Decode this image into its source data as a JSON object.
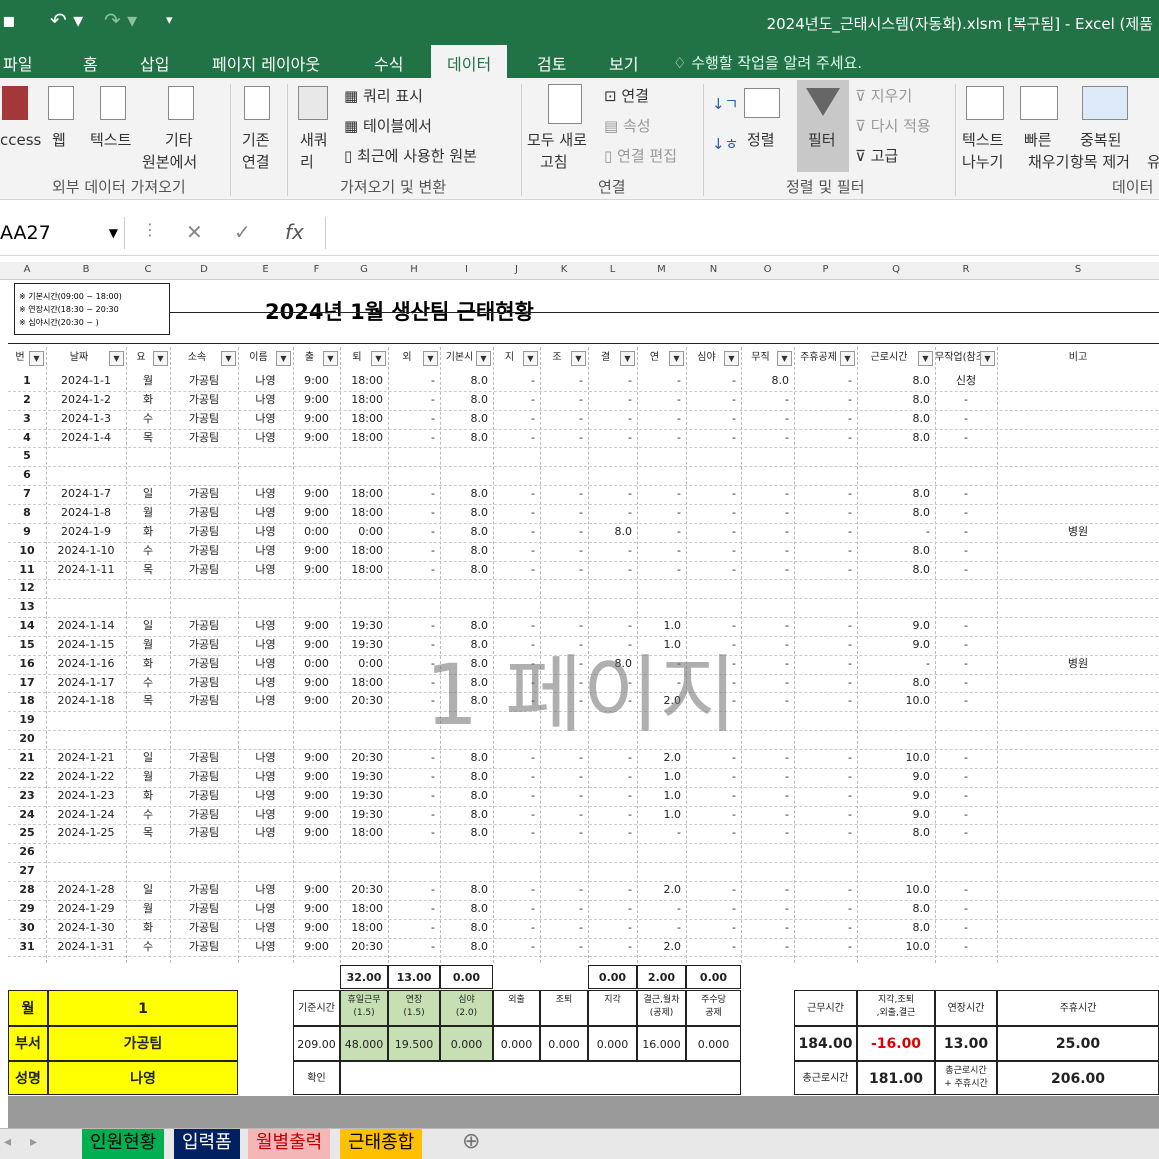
{
  "app": {
    "window_title": "2024년도_근태시스템(자동화).xlsm [복구됨] - Excel (제품",
    "accent": "#217346"
  },
  "ribbon_tabs": [
    "파일",
    "홈",
    "삽입",
    "페이지 레이아웃",
    "수식",
    "데이터",
    "검토",
    "보기"
  ],
  "active_tab": "데이터",
  "tell_me": "수행할 작업을 알려 주세요.",
  "ribbon": {
    "access": "ccess",
    "web": "웹",
    "text": "텍스트",
    "other_line1": "기타",
    "other_line2": "원본에서",
    "existing_line1": "기존",
    "existing_line2": "연결",
    "new_query_line1": "새쿼",
    "new_query_line2": "리",
    "show_query": "쿼리 표시",
    "from_table": "테이블에서",
    "recent_sources": "최근에 사용한 원본",
    "refresh_line1": "모두 새로",
    "refresh_line2": "고침",
    "connections": "연결",
    "properties": "속성",
    "edit_links": "연결 편집",
    "sort": "정렬",
    "filter": "필터",
    "clear": "지우기",
    "reapply": "다시 적용",
    "advanced": "고급",
    "text_to_col_line1": "텍스트",
    "text_to_col_line2": "나누기",
    "flash_fill_line1": "빠른",
    "flash_fill_line2": "채우기",
    "remove_dup_line1": "중복된",
    "remove_dup_line2": "항목 제거",
    "more": "유",
    "groups": {
      "external": "외부 데이터 가져오기",
      "get_transform": "가져오기 및 변환",
      "connections": "연결",
      "sort_filter": "정렬 및 필터",
      "data_tools": "데이터"
    }
  },
  "formula_bar": {
    "name_box": "AA27",
    "fx": "fx",
    "value": ""
  },
  "columns": [
    "A",
    "B",
    "C",
    "D",
    "E",
    "F",
    "G",
    "H",
    "I",
    "J",
    "K",
    "L",
    "M",
    "N",
    "O",
    "P",
    "Q",
    "R",
    "S"
  ],
  "sheet": {
    "notes": [
      "※ 기본시간(09:00 ~ 18:00)",
      "※ 연장시간(18:30 ~ 20:30",
      "※ 심야시간(20:30 ~ )"
    ],
    "title": "2024년 1월  생산팀 근태현황",
    "headers": [
      "번",
      "날짜",
      "요",
      "소속",
      "이름",
      "출",
      "퇴",
      "외",
      "기본시",
      "지",
      "조",
      "결",
      "연",
      "심야",
      "무직",
      "주휴공제",
      "근로시간",
      "무작업(참조",
      "비고"
    ],
    "rows": [
      [
        "1",
        "2024-1-1",
        "월",
        "가공팀",
        "나영",
        "9:00",
        "18:00",
        "-",
        "8.0",
        "-",
        "-",
        "-",
        "-",
        "-",
        "8.0",
        "-",
        "8.0",
        "신청",
        ""
      ],
      [
        "2",
        "2024-1-2",
        "화",
        "가공팀",
        "나영",
        "9:00",
        "18:00",
        "-",
        "8.0",
        "-",
        "-",
        "-",
        "-",
        "-",
        "-",
        "-",
        "8.0",
        "-",
        ""
      ],
      [
        "3",
        "2024-1-3",
        "수",
        "가공팀",
        "나영",
        "9:00",
        "18:00",
        "-",
        "8.0",
        "-",
        "-",
        "-",
        "-",
        "-",
        "-",
        "-",
        "8.0",
        "-",
        ""
      ],
      [
        "4",
        "2024-1-4",
        "목",
        "가공팀",
        "나영",
        "9:00",
        "18:00",
        "-",
        "8.0",
        "-",
        "-",
        "-",
        "-",
        "-",
        "-",
        "-",
        "8.0",
        "-",
        ""
      ],
      [
        "5",
        "",
        "",
        "",
        "",
        "",
        "",
        "",
        "",
        "",
        "",
        "",
        "",
        "",
        "",
        "",
        "",
        "",
        ""
      ],
      [
        "6",
        "",
        "",
        "",
        "",
        "",
        "",
        "",
        "",
        "",
        "",
        "",
        "",
        "",
        "",
        "",
        "",
        "",
        ""
      ],
      [
        "7",
        "2024-1-7",
        "일",
        "가공팀",
        "나영",
        "9:00",
        "18:00",
        "-",
        "8.0",
        "-",
        "-",
        "-",
        "-",
        "-",
        "-",
        "-",
        "8.0",
        "-",
        ""
      ],
      [
        "8",
        "2024-1-8",
        "월",
        "가공팀",
        "나영",
        "9:00",
        "18:00",
        "-",
        "8.0",
        "-",
        "-",
        "-",
        "-",
        "-",
        "-",
        "-",
        "8.0",
        "-",
        ""
      ],
      [
        "9",
        "2024-1-9",
        "화",
        "가공팀",
        "나영",
        "0:00",
        "0:00",
        "-",
        "8.0",
        "-",
        "-",
        "8.0",
        "-",
        "-",
        "-",
        "-",
        "-",
        "-",
        "병원"
      ],
      [
        "10",
        "2024-1-10",
        "수",
        "가공팀",
        "나영",
        "9:00",
        "18:00",
        "-",
        "8.0",
        "-",
        "-",
        "-",
        "-",
        "-",
        "-",
        "-",
        "8.0",
        "-",
        ""
      ],
      [
        "11",
        "2024-1-11",
        "목",
        "가공팀",
        "나영",
        "9:00",
        "18:00",
        "-",
        "8.0",
        "-",
        "-",
        "-",
        "-",
        "-",
        "-",
        "-",
        "8.0",
        "-",
        ""
      ],
      [
        "12",
        "",
        "",
        "",
        "",
        "",
        "",
        "",
        "",
        "",
        "",
        "",
        "",
        "",
        "",
        "",
        "",
        "",
        ""
      ],
      [
        "13",
        "",
        "",
        "",
        "",
        "",
        "",
        "",
        "",
        "",
        "",
        "",
        "",
        "",
        "",
        "",
        "",
        "",
        ""
      ],
      [
        "14",
        "2024-1-14",
        "일",
        "가공팀",
        "나영",
        "9:00",
        "19:30",
        "-",
        "8.0",
        "-",
        "-",
        "-",
        "1.0",
        "-",
        "-",
        "-",
        "9.0",
        "-",
        ""
      ],
      [
        "15",
        "2024-1-15",
        "월",
        "가공팀",
        "나영",
        "9:00",
        "19:30",
        "-",
        "8.0",
        "-",
        "-",
        "-",
        "1.0",
        "-",
        "-",
        "-",
        "9.0",
        "-",
        ""
      ],
      [
        "16",
        "2024-1-16",
        "화",
        "가공팀",
        "나영",
        "0:00",
        "0:00",
        "-",
        "8.0",
        "-",
        "-",
        "8.0",
        "-",
        "-",
        "-",
        "-",
        "-",
        "-",
        "병원"
      ],
      [
        "17",
        "2024-1-17",
        "수",
        "가공팀",
        "나영",
        "9:00",
        "18:00",
        "-",
        "8.0",
        "-",
        "-",
        "-",
        "-",
        "-",
        "-",
        "-",
        "8.0",
        "-",
        ""
      ],
      [
        "18",
        "2024-1-18",
        "목",
        "가공팀",
        "나영",
        "9:00",
        "20:30",
        "-",
        "8.0",
        "-",
        "-",
        "-",
        "2.0",
        "-",
        "-",
        "-",
        "10.0",
        "-",
        ""
      ],
      [
        "19",
        "",
        "",
        "",
        "",
        "",
        "",
        "",
        "",
        "",
        "",
        "",
        "",
        "",
        "",
        "",
        "",
        "",
        ""
      ],
      [
        "20",
        "",
        "",
        "",
        "",
        "",
        "",
        "",
        "",
        "",
        "",
        "",
        "",
        "",
        "",
        "",
        "",
        "",
        ""
      ],
      [
        "21",
        "2024-1-21",
        "일",
        "가공팀",
        "나영",
        "9:00",
        "20:30",
        "-",
        "8.0",
        "-",
        "-",
        "-",
        "2.0",
        "-",
        "-",
        "-",
        "10.0",
        "-",
        ""
      ],
      [
        "22",
        "2024-1-22",
        "월",
        "가공팀",
        "나영",
        "9:00",
        "19:30",
        "-",
        "8.0",
        "-",
        "-",
        "-",
        "1.0",
        "-",
        "-",
        "-",
        "9.0",
        "-",
        ""
      ],
      [
        "23",
        "2024-1-23",
        "화",
        "가공팀",
        "나영",
        "9:00",
        "19:30",
        "-",
        "8.0",
        "-",
        "-",
        "-",
        "1.0",
        "-",
        "-",
        "-",
        "9.0",
        "-",
        ""
      ],
      [
        "24",
        "2024-1-24",
        "수",
        "가공팀",
        "나영",
        "9:00",
        "19:30",
        "-",
        "8.0",
        "-",
        "-",
        "-",
        "1.0",
        "-",
        "-",
        "-",
        "9.0",
        "-",
        ""
      ],
      [
        "25",
        "2024-1-25",
        "목",
        "가공팀",
        "나영",
        "9:00",
        "18:00",
        "-",
        "8.0",
        "-",
        "-",
        "-",
        "-",
        "-",
        "-",
        "-",
        "8.0",
        "-",
        ""
      ],
      [
        "26",
        "",
        "",
        "",
        "",
        "",
        "",
        "",
        "",
        "",
        "",
        "",
        "",
        "",
        "",
        "",
        "",
        "",
        ""
      ],
      [
        "27",
        "",
        "",
        "",
        "",
        "",
        "",
        "",
        "",
        "",
        "",
        "",
        "",
        "",
        "",
        "",
        "",
        "",
        ""
      ],
      [
        "28",
        "2024-1-28",
        "일",
        "가공팀",
        "나영",
        "9:00",
        "20:30",
        "-",
        "8.0",
        "-",
        "-",
        "-",
        "2.0",
        "-",
        "-",
        "-",
        "10.0",
        "-",
        ""
      ],
      [
        "29",
        "2024-1-29",
        "월",
        "가공팀",
        "나영",
        "9:00",
        "18:00",
        "-",
        "8.0",
        "-",
        "-",
        "-",
        "-",
        "-",
        "-",
        "-",
        "8.0",
        "-",
        ""
      ],
      [
        "30",
        "2024-1-30",
        "화",
        "가공팀",
        "나영",
        "9:00",
        "18:00",
        "-",
        "8.0",
        "-",
        "-",
        "-",
        "-",
        "-",
        "-",
        "-",
        "8.0",
        "-",
        ""
      ],
      [
        "31",
        "2024-1-31",
        "수",
        "가공팀",
        "나영",
        "9:00",
        "20:30",
        "-",
        "8.0",
        "-",
        "-",
        "-",
        "2.0",
        "-",
        "-",
        "-",
        "10.0",
        "-",
        ""
      ]
    ],
    "watermark": "1 페이지"
  },
  "summary": {
    "totals": [
      "32.00",
      "13.00",
      "0.00",
      "0.00",
      "2.00",
      "0.00"
    ],
    "month_label": "월",
    "month": "1",
    "dept_label": "부서",
    "dept": "가공팀",
    "name_label": "성명",
    "name": "나영",
    "base_label": "기준시간",
    "base_value": "209.00",
    "confirm_label": "확인",
    "headers": [
      "휴일근무\n(1.5)",
      "연장\n(1.5)",
      "심야\n(2.0)",
      "외출",
      "조퇴",
      "지각",
      "결근,월차\n(공제)",
      "주수당\n공제"
    ],
    "values": [
      "48.000",
      "19.500",
      "0.000",
      "0.000",
      "0.000",
      "0.000",
      "16.000",
      "0.000"
    ],
    "work_label": "근무시간",
    "work_value": "184.00",
    "late_label": "지각,조퇴\n,외출,결근",
    "late_value": "-16.00",
    "ext_label": "연장시간",
    "ext_value": "13.00",
    "weekly_label": "주휴시간",
    "weekly_value": "25.00",
    "total_work_label": "총근로시간",
    "total_work_value": "181.00",
    "total_plus_label": "총근로시간\n+ 주휴시간",
    "total_plus_value": "206.00"
  },
  "sheet_tabs": [
    {
      "label": "인원현황",
      "bg": "#00b050",
      "fg": "#000000"
    },
    {
      "label": "입력폼",
      "bg": "#002060",
      "fg": "#ffffff"
    },
    {
      "label": "월별출력",
      "bg": "#f4b6b6",
      "fg": "#c00000"
    },
    {
      "label": "근태종합",
      "bg": "#ffc000",
      "fg": "#000000"
    }
  ]
}
